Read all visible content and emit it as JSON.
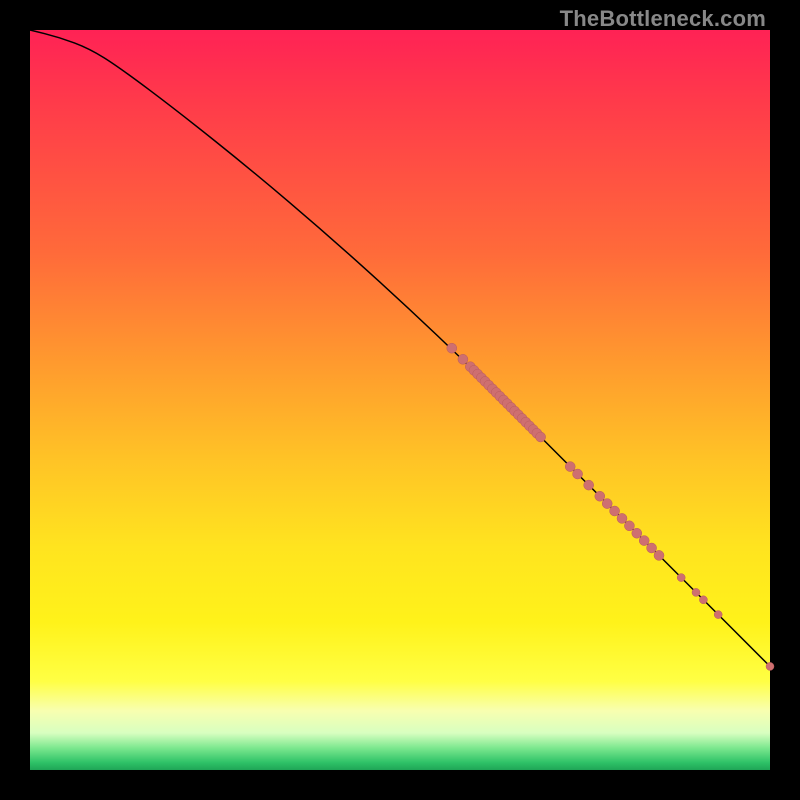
{
  "watermark": "TheBottleneck.com",
  "colors": {
    "background": "#000000",
    "gradient_top": "#ff2255",
    "gradient_mid": "#ffe41f",
    "gradient_bottom": "#1fa556",
    "curve": "#000000",
    "point_fill": "#ce6f70"
  },
  "chart_data": {
    "type": "line",
    "title": "",
    "xlabel": "",
    "ylabel": "",
    "xlim": [
      0,
      100
    ],
    "ylim": [
      0,
      100
    ],
    "grid": false,
    "legend": false,
    "curve": {
      "x": [
        0,
        4,
        8,
        12,
        20,
        30,
        40,
        50,
        60,
        70,
        80,
        90,
        100
      ],
      "y": [
        100,
        99,
        97.5,
        95,
        89,
        81,
        72.5,
        63.5,
        54,
        44,
        34,
        24,
        14
      ]
    },
    "series": [
      {
        "name": "markers",
        "type": "scatter",
        "x": [
          57,
          58.5,
          59.5,
          60,
          60.5,
          61,
          61.5,
          62,
          62.5,
          63,
          63.5,
          64,
          64.5,
          65,
          65.5,
          66,
          66.5,
          67,
          67.5,
          68,
          68.5,
          69,
          73,
          74,
          75.5,
          77,
          78,
          79,
          80,
          81,
          82,
          83,
          84,
          85,
          88,
          90,
          91,
          93,
          100
        ],
        "y": [
          57,
          55.5,
          54.5,
          54,
          53.5,
          53,
          52.5,
          52,
          51.5,
          51,
          50.5,
          50,
          49.5,
          49,
          48.5,
          48,
          47.5,
          47,
          46.5,
          46,
          45.5,
          45,
          41,
          40,
          38.5,
          37,
          36,
          35,
          34,
          33,
          32,
          31,
          30,
          29,
          26,
          24,
          23,
          21,
          14
        ],
        "r": [
          5,
          5,
          5,
          5,
          5,
          5,
          5,
          5,
          5,
          5,
          5,
          5,
          5,
          5,
          5,
          5,
          5,
          5,
          5,
          5,
          5,
          5,
          5,
          5,
          5,
          5,
          5,
          5,
          5,
          5,
          5,
          5,
          5,
          5,
          4,
          4,
          4,
          4,
          4
        ]
      }
    ]
  }
}
